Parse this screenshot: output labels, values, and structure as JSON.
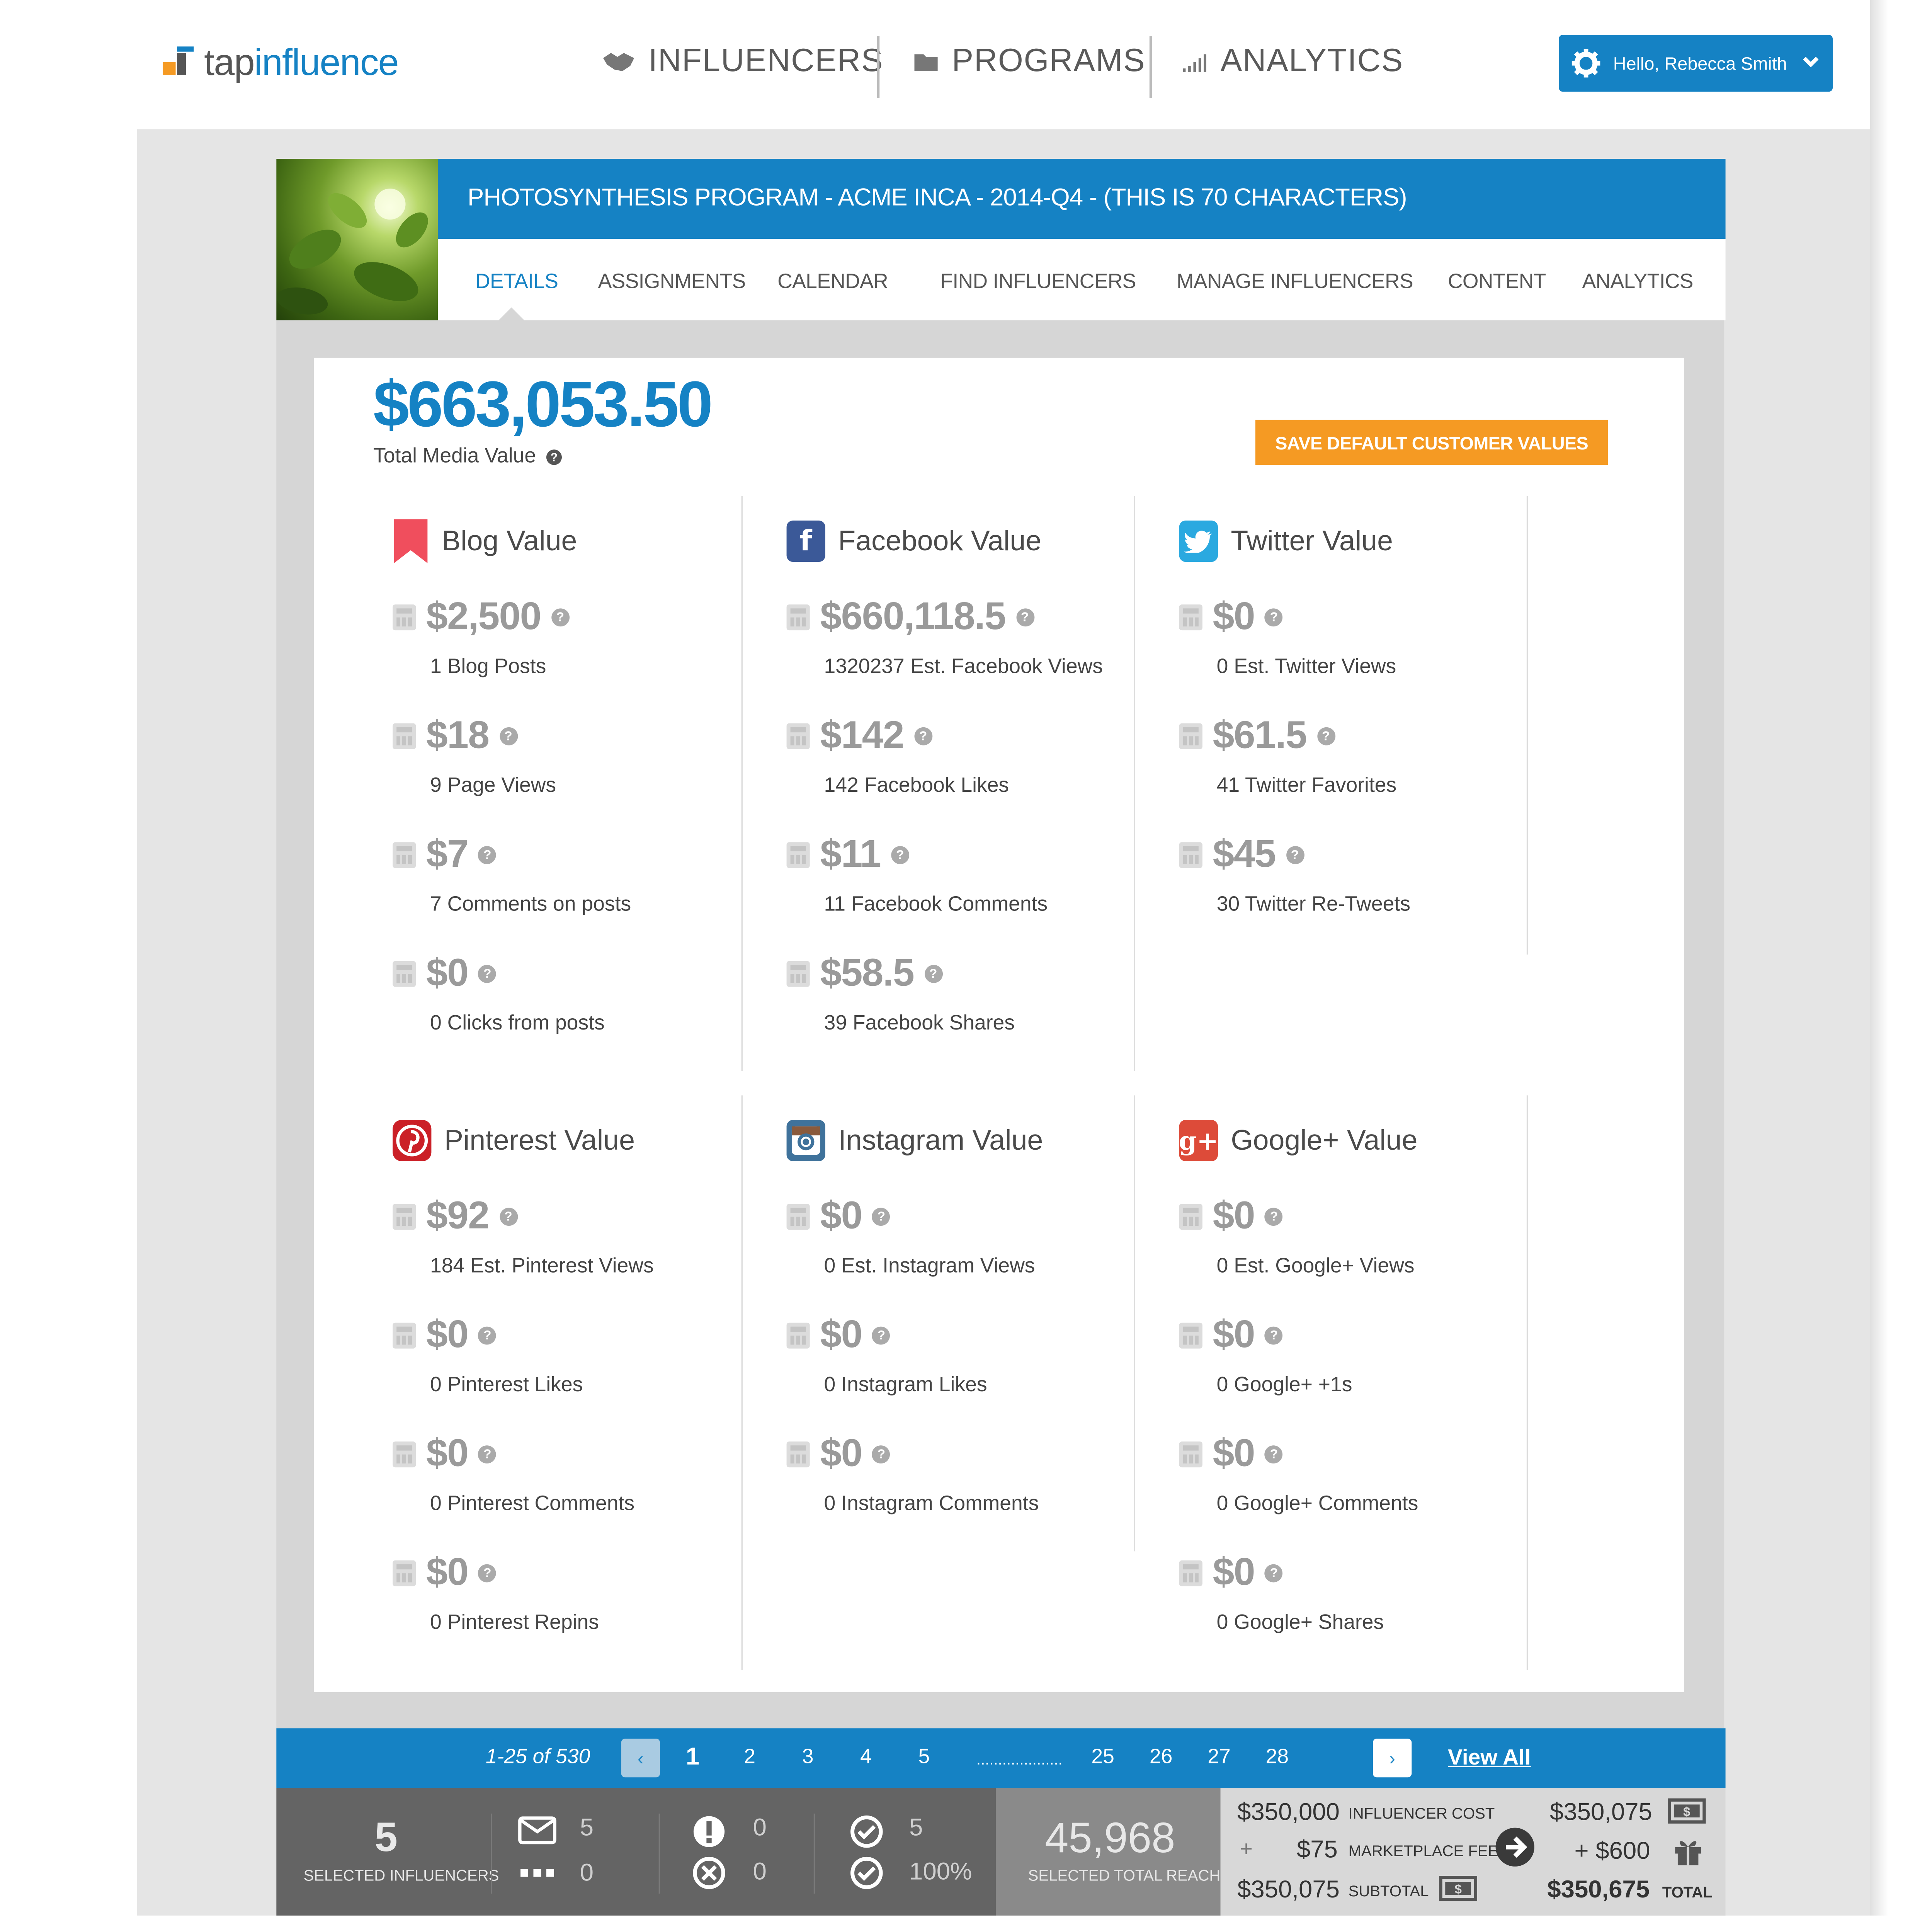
{
  "app": {
    "logo_tap": "tap",
    "logo_influence": "influence"
  },
  "nav": {
    "influencers": "INFLUENCERS",
    "programs": "PROGRAMS",
    "analytics": "ANALYTICS"
  },
  "user": {
    "greeting": "Hello, Rebecca Smith"
  },
  "program": {
    "title": "PHOTOSYNTHESIS PROGRAM - ACME INCA - 2014-Q4 - (THIS IS 70 CHARACTERS)"
  },
  "tabs": [
    {
      "label": "DETAILS",
      "active": true
    },
    {
      "label": "ASSIGNMENTS",
      "active": false
    },
    {
      "label": "CALENDAR",
      "active": false
    },
    {
      "label": "FIND INFLUENCERS",
      "active": false
    },
    {
      "label": "MANAGE INFLUENCERS",
      "active": false
    },
    {
      "label": "CONTENT",
      "active": false
    },
    {
      "label": "ANALYTICS",
      "active": false
    }
  ],
  "summary": {
    "total_value": "$663,053.50",
    "total_label": "Total Media Value",
    "save_button": "SAVE DEFAULT CUSTOMER VALUES"
  },
  "cards": {
    "blog": {
      "title": "Blog Value",
      "icon": "bookmark-icon",
      "color": "#f04e5d",
      "metrics": [
        {
          "value": "$2,500",
          "label": "1 Blog Posts"
        },
        {
          "value": "$18",
          "label": "9 Page Views"
        },
        {
          "value": "$7",
          "label": "7 Comments on posts"
        },
        {
          "value": "$0",
          "label": "0 Clicks from posts"
        }
      ]
    },
    "facebook": {
      "title": "Facebook Value",
      "icon": "facebook-icon",
      "color": "#3b5998",
      "metrics": [
        {
          "value": "$660,118.5",
          "label": "1320237 Est. Facebook Views"
        },
        {
          "value": "$142",
          "label": "142 Facebook Likes"
        },
        {
          "value": "$11",
          "label": "11 Facebook Comments"
        },
        {
          "value": "$58.5",
          "label": "39 Facebook Shares"
        }
      ]
    },
    "twitter": {
      "title": "Twitter Value",
      "icon": "twitter-icon",
      "color": "#2aa9e0",
      "metrics": [
        {
          "value": "$0",
          "label": "0 Est. Twitter Views"
        },
        {
          "value": "$61.5",
          "label": "41 Twitter Favorites"
        },
        {
          "value": "$45",
          "label": "30 Twitter Re-Tweets"
        }
      ]
    },
    "pinterest": {
      "title": "Pinterest Value",
      "icon": "pinterest-icon",
      "color": "#cb2027",
      "metrics": [
        {
          "value": "$92",
          "label": "184 Est. Pinterest Views"
        },
        {
          "value": "$0",
          "label": "0 Pinterest Likes"
        },
        {
          "value": "$0",
          "label": "0 Pinterest Comments"
        },
        {
          "value": "$0",
          "label": "0 Pinterest Repins"
        }
      ]
    },
    "instagram": {
      "title": "Instagram Value",
      "icon": "instagram-icon",
      "color": "#3f729b",
      "metrics": [
        {
          "value": "$0",
          "label": "0 Est. Instagram Views"
        },
        {
          "value": "$0",
          "label": "0 Instagram Likes"
        },
        {
          "value": "$0",
          "label": "0 Instagram Comments"
        }
      ]
    },
    "googleplus": {
      "title": "Google+ Value",
      "icon": "google-plus-icon",
      "color": "#dd4b39",
      "metrics": [
        {
          "value": "$0",
          "label": "0 Est. Google+ Views"
        },
        {
          "value": "$0",
          "label": "0 Google+ +1s"
        },
        {
          "value": "$0",
          "label": "0 Google+ Comments"
        },
        {
          "value": "$0",
          "label": "0 Google+ Shares"
        }
      ]
    }
  },
  "pagination": {
    "range": "1-25 of 530",
    "pages_left": [
      "1",
      "2",
      "3",
      "4",
      "5"
    ],
    "ellipsis": "....................",
    "pages_right": [
      "25",
      "26",
      "27",
      "28"
    ],
    "view_all": "View All"
  },
  "footer": {
    "selected_count": "5",
    "selected_label": "SELECTED INFLUENCERS",
    "mail_count": "5",
    "more_count": "0",
    "alert_count": "0",
    "rejected_count": "0",
    "approved_count": "5",
    "approved_pct": "100%",
    "reach": "45,968",
    "reach_label": "SELECTED TOTAL REACH",
    "influencer_cost": "$350,000",
    "influencer_cost_label": "INFLUENCER COST",
    "plus": "+",
    "marketplace_fee": "$75",
    "marketplace_fee_label": "MARKETPLACE FEE",
    "subtotal": "$350,075",
    "subtotal_label": "SUBTOTAL",
    "right_subtotal": "$350,075",
    "gift_amount": "+ $600",
    "total": "$350,675",
    "total_label": "TOTAL"
  },
  "colors": {
    "accent": "#1582c4",
    "button_orange": "#f59a23"
  }
}
